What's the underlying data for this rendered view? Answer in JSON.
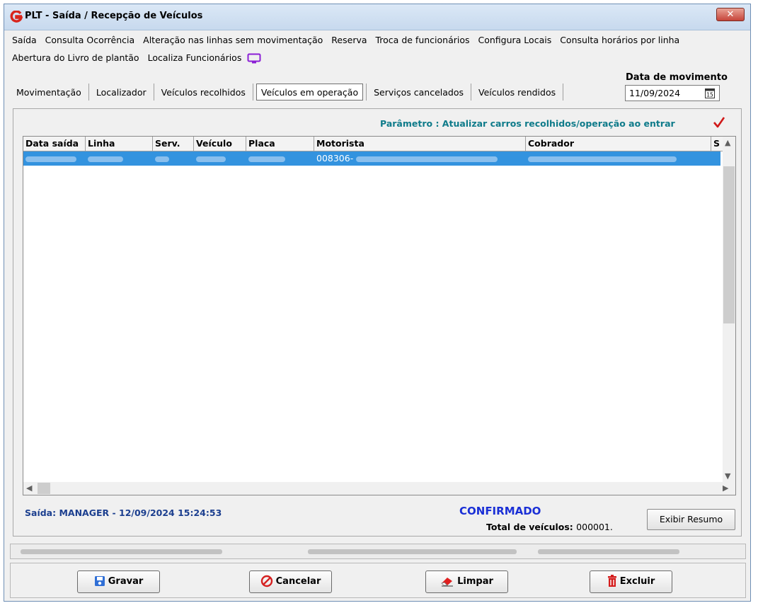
{
  "window": {
    "title": "PLT - Saída / Recepção de Veículos",
    "close_label": "✕"
  },
  "menu": {
    "row1": [
      "Saída",
      "Consulta Ocorrência",
      "Alteração nas linhas sem movimentação",
      "Reserva",
      "Troca de funcionários",
      "Configura Locais",
      "Consulta horários por linha"
    ],
    "row2": [
      "Abertura do Livro de plantão",
      "Localiza Funcionários"
    ]
  },
  "tabs": [
    "Movimentação",
    "Localizador",
    "Veículos recolhidos",
    "Veículos em operação",
    "Serviços cancelados",
    "Veículos rendidos"
  ],
  "active_tab": "Veículos em operação",
  "date": {
    "label": "Data de movimento",
    "value": "11/09/2024",
    "calendar_icon": "calendar-icon"
  },
  "parameter_text": "Parâmetro : Atualizar carros recolhidos/operação ao entrar",
  "grid": {
    "columns": [
      "Data saída",
      "Linha",
      "Serv.",
      "Veículo",
      "Placa",
      "Motorista",
      "Cobrador",
      "S"
    ],
    "rows": [
      {
        "motorista": "008306-"
      }
    ]
  },
  "footer": {
    "exit_info": "Saída: MANAGER - 12/09/2024 15:24:53",
    "status": "CONFIRMADO",
    "total_label": "Total de veículos:",
    "total_value": "000001.",
    "summary_button": "Exibir Resumo"
  },
  "buttons": {
    "save": "Gravar",
    "cancel": "Cancelar",
    "clear": "Limpar",
    "delete": "Excluir"
  },
  "colors": {
    "selection": "#3393df",
    "parameter_text": "#0f7b8a",
    "status_text": "#1a2fd6",
    "exit_text": "#1c3f8f",
    "check_mark": "#d01818"
  }
}
